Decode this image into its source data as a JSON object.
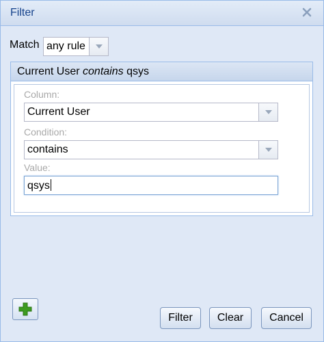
{
  "dialog": {
    "title": "Filter",
    "close_icon": "close-icon"
  },
  "match": {
    "label": "Match",
    "value": "any rule"
  },
  "rule": {
    "header_field": "Current User",
    "header_operator": "contains",
    "header_value": "qsys",
    "column_label": "Column:",
    "column_value": "Current User",
    "condition_label": "Condition:",
    "condition_value": "contains",
    "value_label": "Value:",
    "value_text": "qsys"
  },
  "buttons": {
    "add_icon": "plus-icon",
    "filter": "Filter",
    "clear": "Clear",
    "cancel": "Cancel"
  },
  "colors": {
    "title_text": "#15428b",
    "panel_border": "#99bbe8",
    "dialog_bg": "#dfe8f6",
    "add_icon_green": "#3d9b1f"
  }
}
